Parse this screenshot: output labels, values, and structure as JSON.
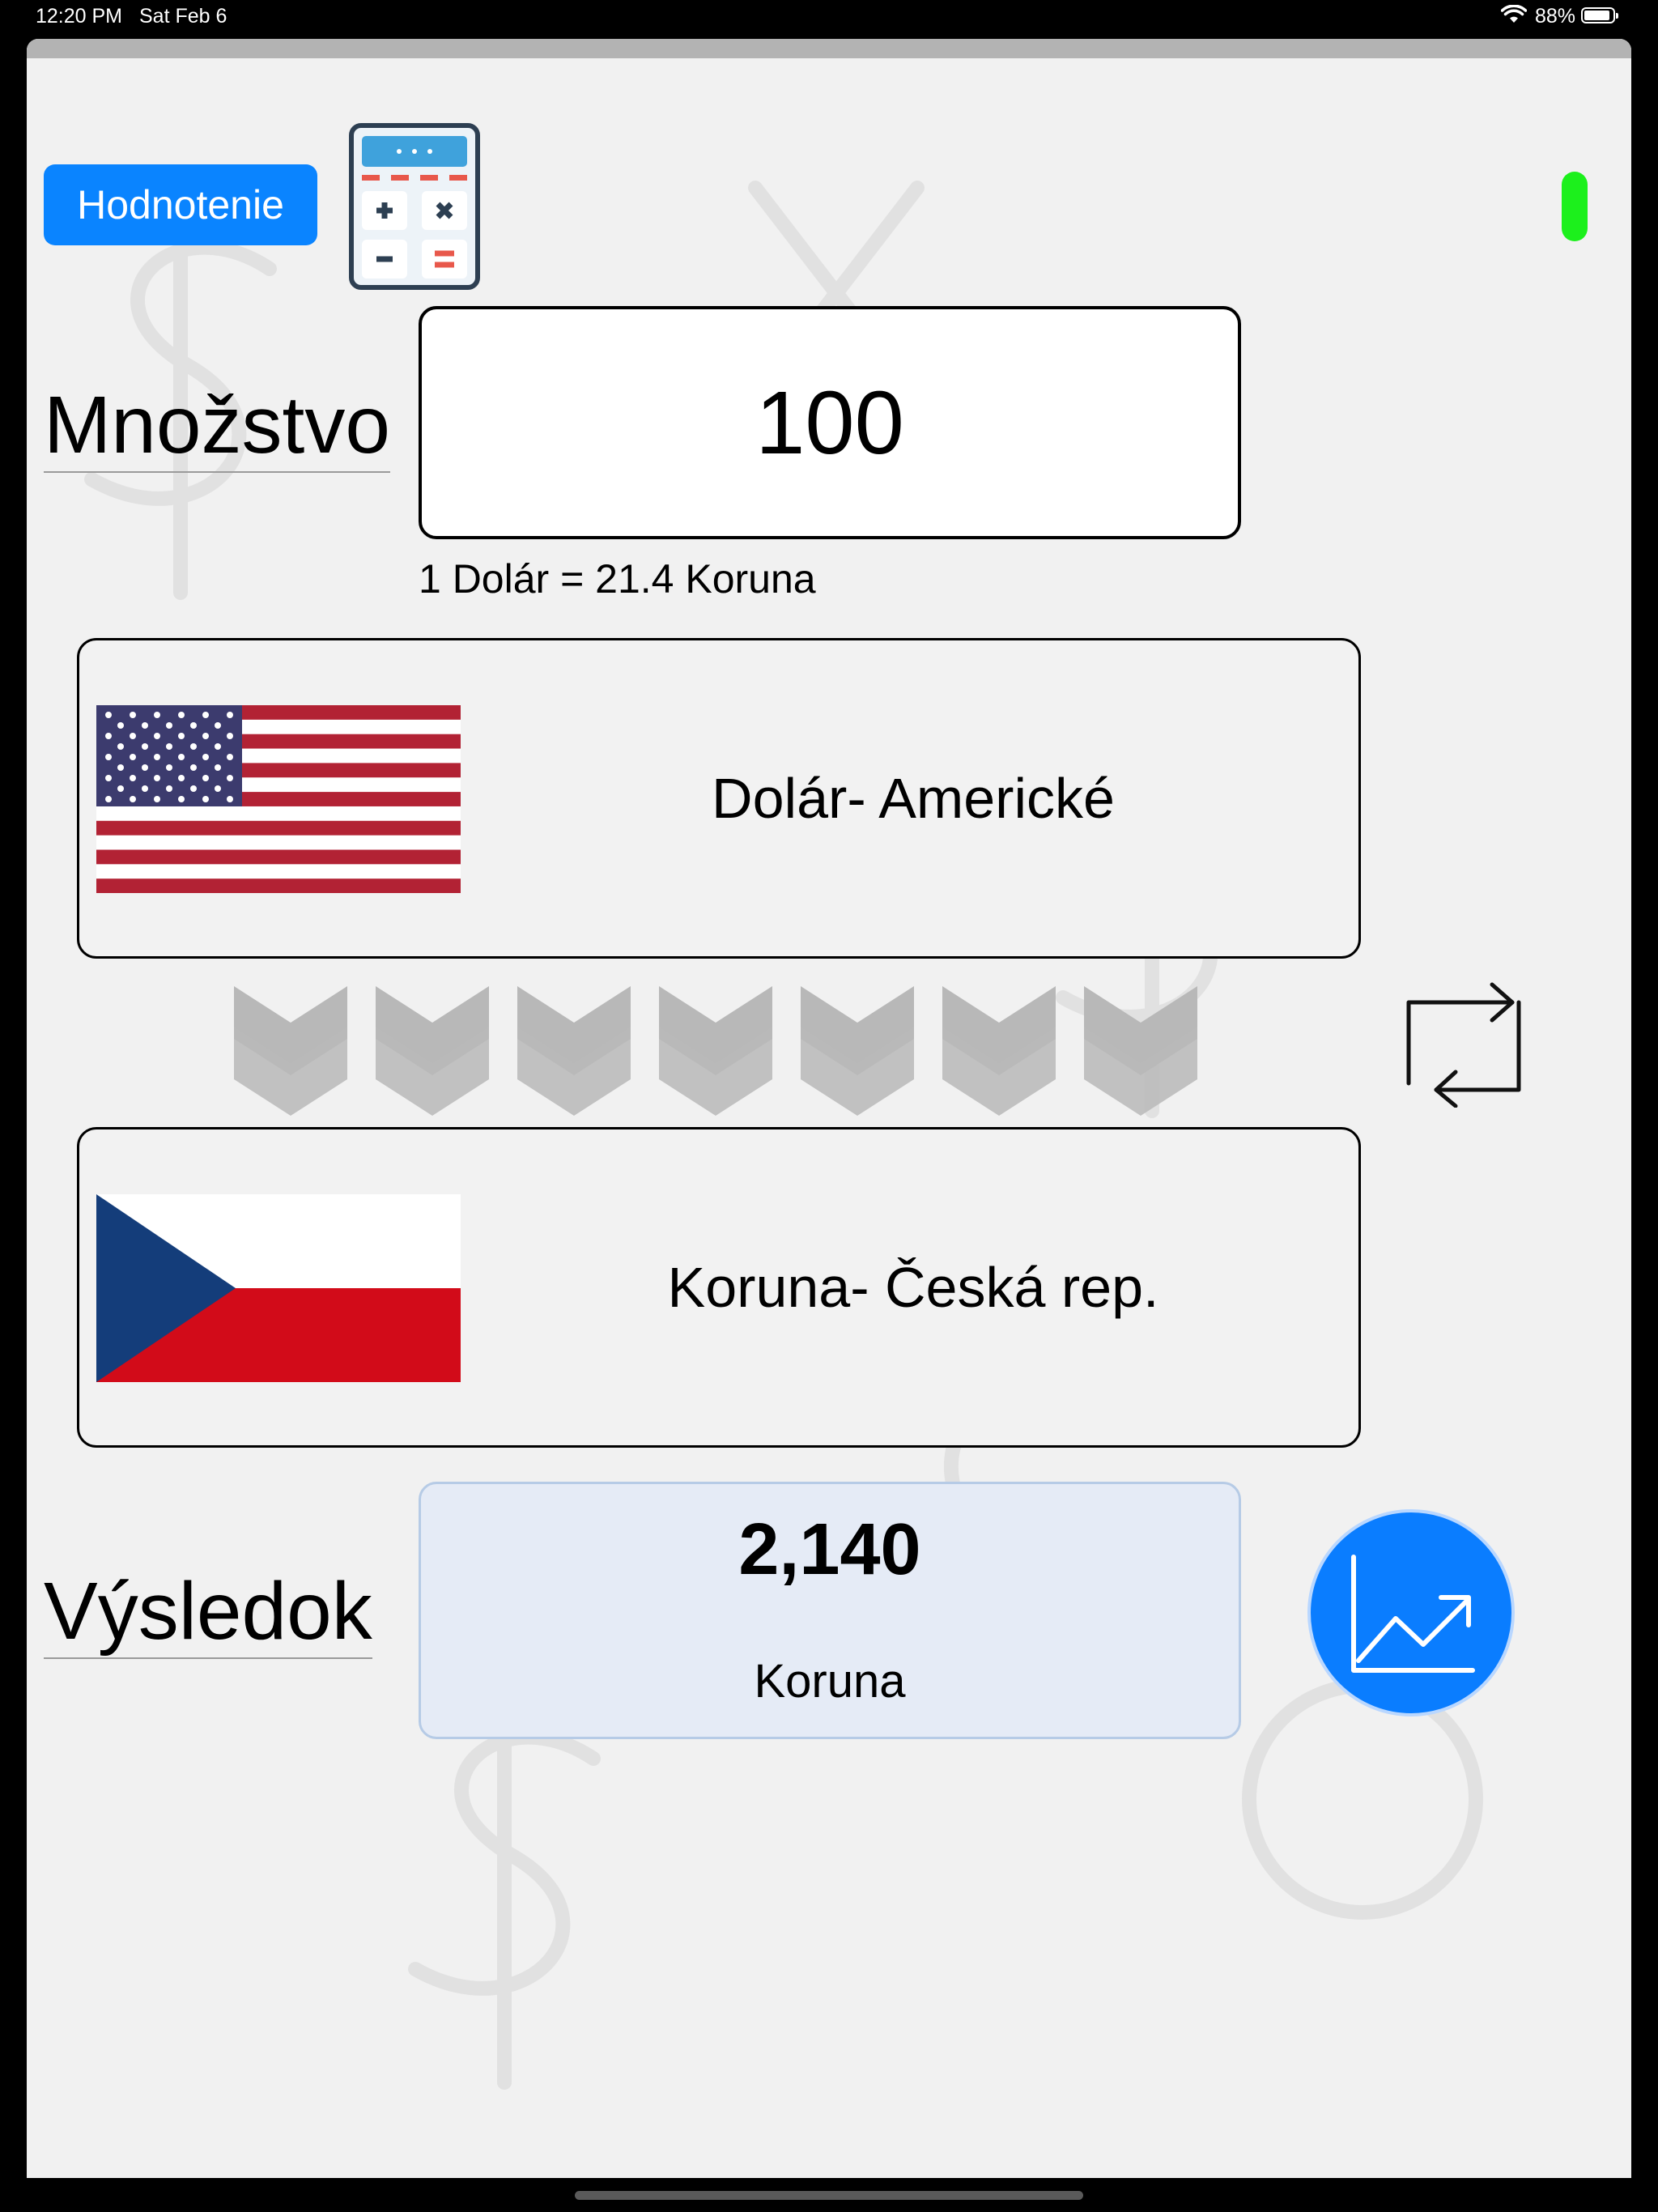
{
  "status_bar": {
    "time": "12:20 PM",
    "date": "Sat Feb 6",
    "battery": "88%"
  },
  "toolbar": {
    "rate_button_label": "Hodnotenie",
    "calculator_icon": "calculator-icon",
    "indicator_color": "#1cf01c"
  },
  "amount": {
    "label": "Množstvo",
    "value": "100",
    "rate_text": "1 Dolár = 21.4 Koruna"
  },
  "from_currency": {
    "name": "Dolár- Americké",
    "flag_icon": "usa-flag-icon"
  },
  "to_currency": {
    "name": "Koruna- Česká rep.",
    "flag_icon": "czech-flag-icon"
  },
  "result": {
    "label": "Výsledok",
    "value": "2,140",
    "currency": "Koruna"
  },
  "colors": {
    "accent": "#0a84ff",
    "result_bg": "#e5ebf6",
    "sheet_bg": "#f1f1f1"
  }
}
